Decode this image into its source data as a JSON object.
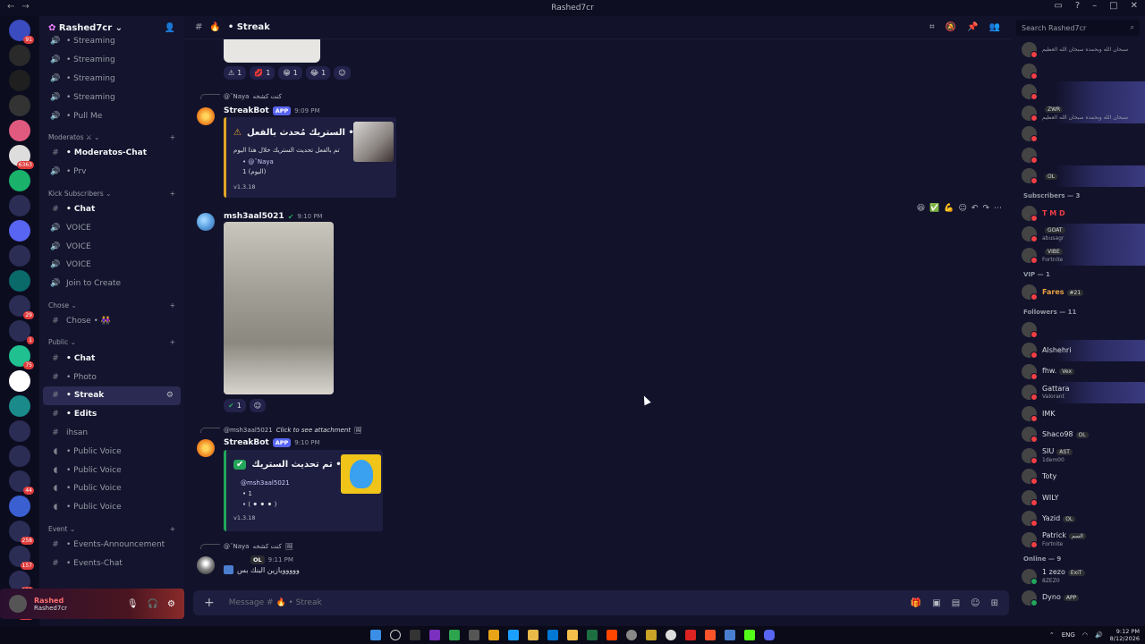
{
  "window": {
    "title": "Rashed7cr"
  },
  "server": {
    "name": "Rashed7cr"
  },
  "channel_list": [
    {
      "type": "channel",
      "icon": "voice-icon",
      "name": "• Streaming",
      "bold": false
    },
    {
      "type": "channel",
      "icon": "voice-icon",
      "name": "• Streaming",
      "bold": false
    },
    {
      "type": "channel",
      "icon": "voice-icon",
      "name": "• Streaming",
      "bold": false
    },
    {
      "type": "channel",
      "icon": "voice-icon",
      "name": "• Streaming",
      "bold": false
    },
    {
      "type": "channel",
      "icon": "voice-icon",
      "name": "• Pull Me",
      "bold": false
    },
    {
      "type": "category",
      "name": "Moderatos",
      "extra": "⚔"
    },
    {
      "type": "channel",
      "icon": "hash-icon",
      "name": "• Moderatos-Chat",
      "bold": true
    },
    {
      "type": "channel",
      "icon": "voice-icon",
      "name": "• Prv",
      "bold": false
    },
    {
      "type": "category",
      "name": "Kick Subscribers",
      "extra": ""
    },
    {
      "type": "channel",
      "icon": "hash-icon",
      "name": "• Chat",
      "bold": true
    },
    {
      "type": "channel",
      "icon": "voice-icon",
      "name": "VOICE",
      "bold": false
    },
    {
      "type": "channel",
      "icon": "voice-icon",
      "name": "VOICE",
      "bold": false
    },
    {
      "type": "channel",
      "icon": "voice-icon",
      "name": "VOICE",
      "bold": false
    },
    {
      "type": "channel",
      "icon": "voice-icon",
      "name": "Join to Create",
      "bold": false
    },
    {
      "type": "category",
      "name": "Chose",
      "extra": ""
    },
    {
      "type": "channel",
      "icon": "hash-icon",
      "name": "Chose • 👭",
      "bold": false
    },
    {
      "type": "category",
      "name": "Public",
      "extra": ""
    },
    {
      "type": "channel",
      "icon": "hash-icon",
      "name": "• Chat",
      "bold": true
    },
    {
      "type": "channel",
      "icon": "hash-icon",
      "name": "• Photo",
      "bold": false
    },
    {
      "type": "channel",
      "icon": "hash-icon",
      "name": "• Streak",
      "bold": true,
      "active": true
    },
    {
      "type": "channel",
      "icon": "hash-icon",
      "name": "• Edits",
      "bold": true
    },
    {
      "type": "channel",
      "icon": "hash-icon",
      "name": "ihsan",
      "bold": false
    },
    {
      "type": "channel",
      "icon": "speaker-icon",
      "name": "• Public Voice",
      "bold": false
    },
    {
      "type": "channel",
      "icon": "speaker-icon",
      "name": "• Public Voice",
      "bold": false
    },
    {
      "type": "channel",
      "icon": "speaker-icon",
      "name": "• Public Voice",
      "bold": false
    },
    {
      "type": "channel",
      "icon": "speaker-icon",
      "name": "• Public Voice",
      "bold": false
    },
    {
      "type": "category",
      "name": "Event",
      "extra": ""
    },
    {
      "type": "channel",
      "icon": "hash-icon",
      "name": "• Events-Announcement",
      "bold": false
    },
    {
      "type": "channel",
      "icon": "hash-icon",
      "name": "• Events-Chat",
      "bold": false
    }
  ],
  "user_panel": {
    "display_name": "Rashed",
    "username": "Rashed7cr"
  },
  "chat_header": {
    "channel": "• Streak"
  },
  "search": {
    "placeholder": "Search Rashed7cr"
  },
  "messages": {
    "reactions_top": [
      {
        "emoji": "⚠",
        "count": "1"
      },
      {
        "emoji": "💋",
        "count": "1"
      },
      {
        "emoji": "😁",
        "count": "1"
      },
      {
        "emoji": "😂",
        "count": "1"
      }
    ],
    "m1": {
      "reply_to": "@ˇNaya",
      "reply_text": "كنت كشخه",
      "author": "StreakBot",
      "app_tag": "APP",
      "time": "9:09 PM",
      "embed_title": "الستريك مُحدث بالفعل •",
      "embed_desc": "تم بالفعل تحديث الستريك خلال هذا اليوم",
      "embed_user": "• @ˇNaya",
      "embed_count": "1 (اليوم)",
      "version": "v1.3.18"
    },
    "m2": {
      "author": "msh3aal5021",
      "time": "9:10 PM",
      "reaction_count": "1"
    },
    "m3": {
      "reply_to": "@msh3aal5021",
      "reply_text": "Click to see attachment",
      "author": "StreakBot",
      "app_tag": "APP",
      "time": "9:10 PM",
      "embed_title": "تم تحديث الستريك •",
      "embed_user": "@msh3aal5021",
      "embed_count": "• 1",
      "embed_history": "• ( ⚫ ⚫ ⚫ )",
      "version": "v1.3.18"
    },
    "m4": {
      "reply_to": "@ˇNaya",
      "reply_text": "كنت كشخه",
      "tag": "OL",
      "time": "9:11 PM",
      "text": "ووووويازين البنك بس"
    }
  },
  "input": {
    "placeholder": "Message # 🔥 • Streak"
  },
  "members": {
    "top": [
      {
        "name": "",
        "sub": "سبحان الله وبحمده سبحان الله العظيم",
        "tag": ""
      },
      {
        "name": "",
        "sub": "",
        "tag": ""
      },
      {
        "name": "",
        "sub": "",
        "tag": ""
      },
      {
        "name": "",
        "sub": "سبحان الله وبحمده سبحان الله العظيم",
        "tag": "ZWR"
      },
      {
        "name": "",
        "sub": "",
        "tag": ""
      },
      {
        "name": "",
        "sub": "",
        "tag": ""
      },
      {
        "name": "",
        "sub": "",
        "tag": "OL"
      }
    ],
    "subscribers_label": "Subscribers — 3",
    "subscribers": [
      {
        "name": "T M D",
        "sub": "",
        "tag": "",
        "color": "#f23f43"
      },
      {
        "name": "",
        "sub": "abusagr",
        "tag": "GOAT",
        "color": "#f23f43"
      },
      {
        "name": "",
        "sub": "Fortnite",
        "tag": "VIBE",
        "color": "#f23f43"
      }
    ],
    "vip_label": "VIP — 1",
    "vip": [
      {
        "name": "Fares",
        "tag": "#21",
        "color": "#e8a040"
      }
    ],
    "followers_label": "Followers — 11",
    "followers": [
      {
        "name": "",
        "sub": "",
        "tag": ""
      },
      {
        "name": "Alshehri",
        "sub": "",
        "tag": ""
      },
      {
        "name": "fhw.",
        "sub": "",
        "tag": "Vex"
      },
      {
        "name": "Gattara",
        "sub": "Valorant",
        "tag": ""
      },
      {
        "name": "IMK",
        "sub": "",
        "tag": ""
      },
      {
        "name": "Shaco98",
        "sub": "",
        "tag": "OL"
      },
      {
        "name": "SIU",
        "sub": "1dem00",
        "tag": "AST"
      },
      {
        "name": "Toty",
        "sub": "",
        "tag": ""
      },
      {
        "name": "WILY",
        "sub": "",
        "tag": ""
      },
      {
        "name": "Yazid",
        "sub": "",
        "tag": "OL"
      },
      {
        "name": "Patrick",
        "sub": "Fortnite",
        "tag": "السم"
      }
    ],
    "online_label": "Online — 9",
    "online": [
      {
        "name": "1 zezo",
        "sub": "8ZEZ0",
        "tag": "ExiT"
      },
      {
        "name": "Dyno",
        "sub": "",
        "tag": "APP"
      }
    ]
  },
  "tray": {
    "lang": "ENG",
    "time": "9:12 PM",
    "date": "8/12/2026"
  },
  "server_badges": [
    "91",
    "",
    "",
    "",
    "",
    "6363",
    "",
    "",
    "",
    "",
    "",
    "29",
    "1",
    "75",
    "",
    "",
    "",
    "",
    "44",
    "",
    "258",
    "157",
    "222",
    "NEW"
  ]
}
